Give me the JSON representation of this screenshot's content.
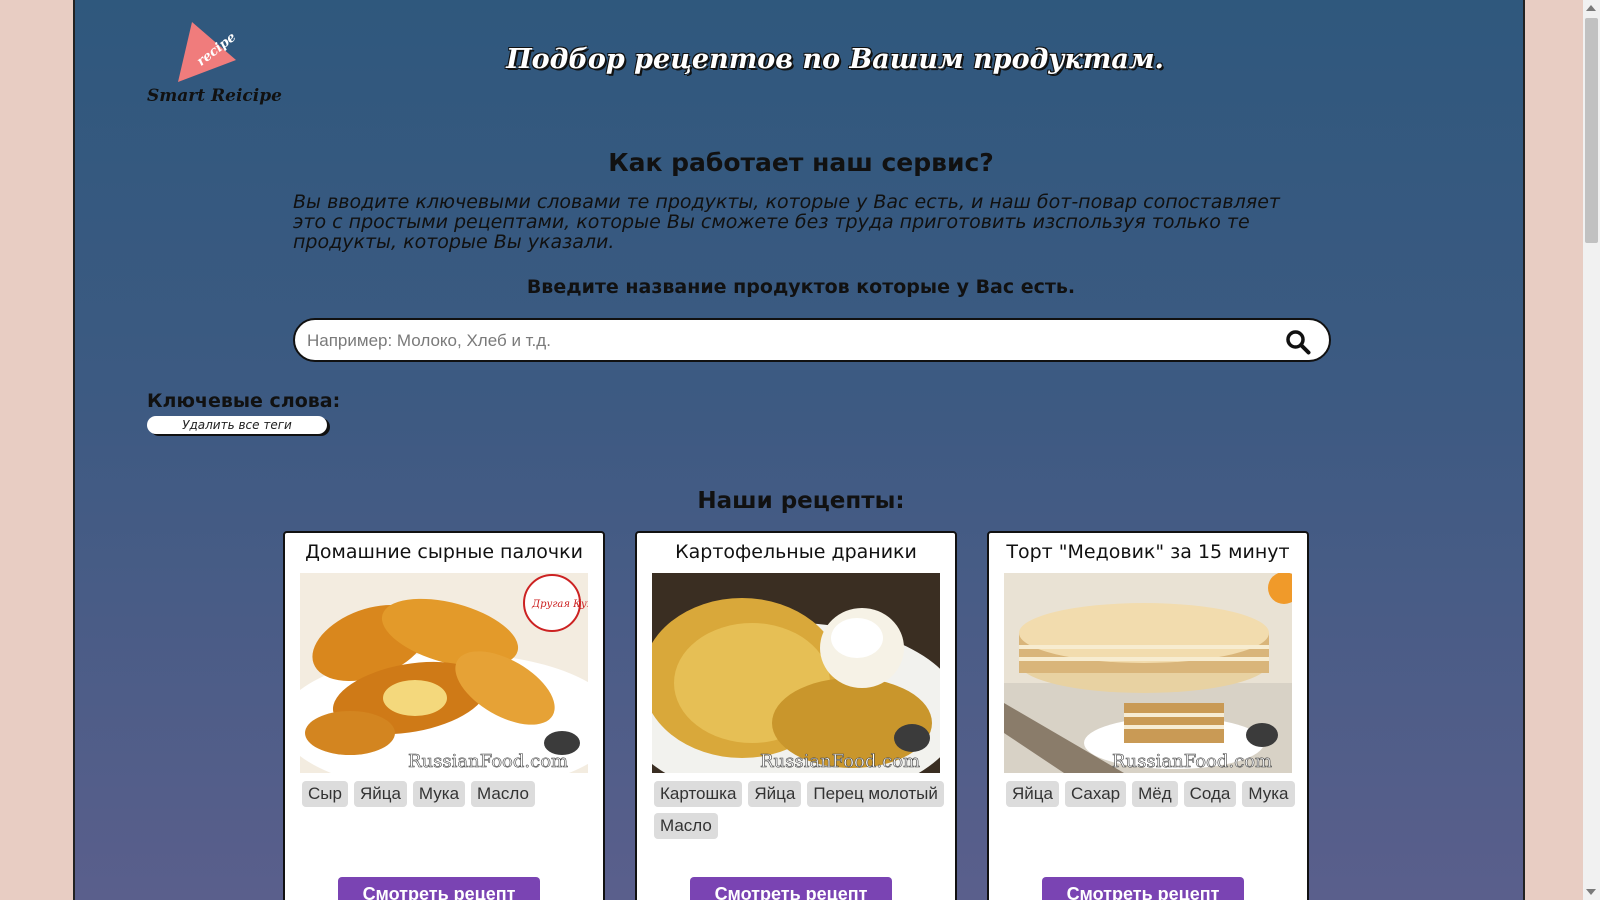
{
  "header": {
    "logo_text": "Smart Reicipe",
    "logo_badge": "recipe",
    "title": "Подбор рецептов по Вашим продуктам."
  },
  "how": {
    "title": "Как работает наш сервис?",
    "description": "Вы вводите ключевыми словами те продукты, которые у Вас есть, и наш бот-повар сопоставляет это с простыми рецептами, которые Вы сможете без труда приготовить изспользуя только те продукты, которые Вы указали."
  },
  "search": {
    "prompt": "Введите название продуктов которые у Вас есть.",
    "placeholder": "Например: Молоко, Хлеб и т.д.",
    "value": "",
    "icon": "search-icon"
  },
  "keywords": {
    "label": "Ключевые слова:",
    "clear_label": "Удалить все теги"
  },
  "recipes": {
    "title": "Наши рецепты:",
    "button_label": "Смотреть рецепт",
    "items": [
      {
        "title": "Домашние сырные палочки",
        "tags": [
          "Сыр",
          "Яйца",
          "Мука",
          "Масло"
        ],
        "watermark": "RussianFood.com",
        "badge": "Другая Кухня"
      },
      {
        "title": "Картофельные драники",
        "tags": [
          "Картошка",
          "Яйца",
          "Перец молотый",
          "Масло"
        ],
        "watermark": "RussianFood.com"
      },
      {
        "title": "Торт \"Медовик\" за 15 минут",
        "tags": [
          "Яйца",
          "Сахар",
          "Мёд",
          "Сода",
          "Мука"
        ],
        "watermark": "RussianFood.com"
      }
    ]
  },
  "colors": {
    "button": "#7a44b3",
    "logo_triangle": "#f07c7c",
    "page_bg": "#e8cdc3"
  }
}
